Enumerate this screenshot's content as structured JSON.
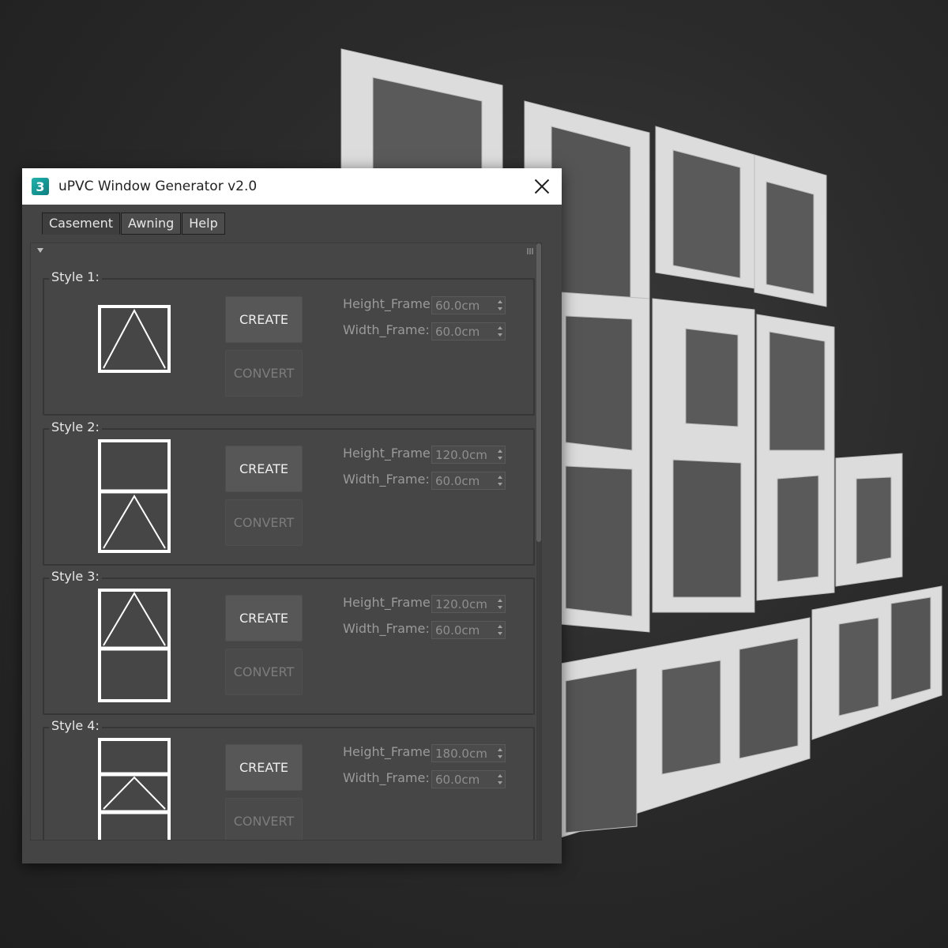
{
  "window": {
    "title": "uPVC Window Generator v2.0",
    "app_icon_label": "3"
  },
  "tabs": [
    {
      "label": "Casement",
      "active": true
    },
    {
      "label": "Awning",
      "active": false
    },
    {
      "label": "Help",
      "active": false
    }
  ],
  "styles": [
    {
      "label": "Style 1:",
      "create_label": "CREATE",
      "convert_label": "CONVERT",
      "height_label": "Height_Frame:",
      "height_value": "60.0cm",
      "width_label": "Width_Frame:",
      "width_value": "60.0cm"
    },
    {
      "label": "Style 2:",
      "create_label": "CREATE",
      "convert_label": "CONVERT",
      "height_label": "Height_Frame:",
      "height_value": "120.0cm",
      "width_label": "Width_Frame:",
      "width_value": "60.0cm"
    },
    {
      "label": "Style 3:",
      "create_label": "CREATE",
      "convert_label": "CONVERT",
      "height_label": "Height_Frame:",
      "height_value": "120.0cm",
      "width_label": "Width_Frame:",
      "width_value": "60.0cm"
    },
    {
      "label": "Style 4:",
      "create_label": "CREATE",
      "convert_label": "CONVERT",
      "height_label": "Height_Frame:",
      "height_value": "180.0cm",
      "width_label": "Width_Frame:",
      "width_value": "60.0cm"
    }
  ],
  "colors": {
    "panel_bg": "#464646",
    "button_bg": "#575757",
    "accent_icon": "#1fb3ac"
  }
}
